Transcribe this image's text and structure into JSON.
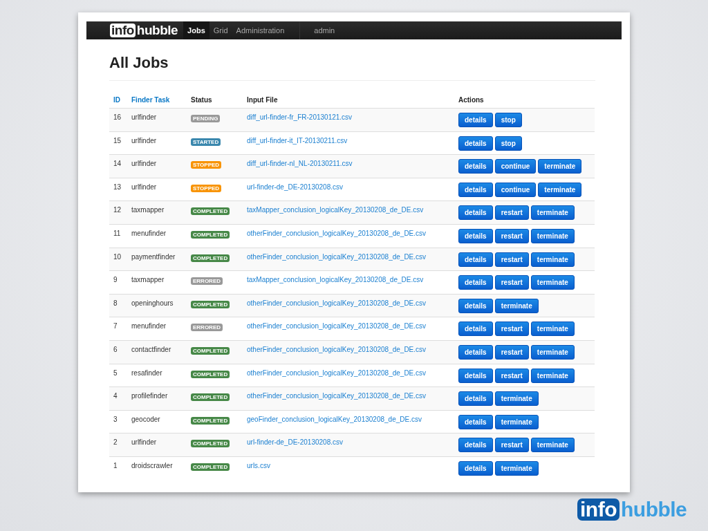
{
  "navbar": {
    "logo": {
      "part_1": "info",
      "part_2": "hubble"
    },
    "items": [
      {
        "label": "Jobs",
        "selected": true
      },
      {
        "label": "Grid",
        "selected": false
      },
      {
        "label": "Administration",
        "selected": false
      }
    ],
    "user": "admin"
  },
  "title": "All Jobs",
  "table": {
    "columns": [
      "ID",
      "Finder Task",
      "Status",
      "Input File",
      "Actions"
    ],
    "rows": [
      {
        "id": "16",
        "task": "urlfinder",
        "status": {
          "label": "PENDING",
          "kind": "pending"
        },
        "file": "diff_url-finder-fr_FR-20130121.csv",
        "actions": [
          "details",
          "stop"
        ]
      },
      {
        "id": "15",
        "task": "urlfinder",
        "status": {
          "label": "STARTED",
          "kind": "started"
        },
        "file": "diff_url-finder-it_IT-20130211.csv",
        "actions": [
          "details",
          "stop"
        ]
      },
      {
        "id": "14",
        "task": "urlfinder",
        "status": {
          "label": "STOPPED",
          "kind": "stopped"
        },
        "file": "diff_url-finder-nl_NL-20130211.csv",
        "actions": [
          "details",
          "continue",
          "terminate"
        ]
      },
      {
        "id": "13",
        "task": "urlfinder",
        "status": {
          "label": "STOPPED",
          "kind": "stopped"
        },
        "file": "url-finder-de_DE-20130208.csv",
        "actions": [
          "details",
          "continue",
          "terminate"
        ]
      },
      {
        "id": "12",
        "task": "taxmapper",
        "status": {
          "label": "COMPLETED",
          "kind": "completed"
        },
        "file": "taxMapper_conclusion_logicalKey_20130208_de_DE.csv",
        "actions": [
          "details",
          "restart",
          "terminate"
        ]
      },
      {
        "id": "11",
        "task": "menufinder",
        "status": {
          "label": "COMPLETED",
          "kind": "completed"
        },
        "file": "otherFinder_conclusion_logicalKey_20130208_de_DE.csv",
        "actions": [
          "details",
          "restart",
          "terminate"
        ]
      },
      {
        "id": "10",
        "task": "paymentfinder",
        "status": {
          "label": "COMPLETED",
          "kind": "completed"
        },
        "file": "otherFinder_conclusion_logicalKey_20130208_de_DE.csv",
        "actions": [
          "details",
          "restart",
          "terminate"
        ]
      },
      {
        "id": "9",
        "task": "taxmapper",
        "status": {
          "label": "ERRORED",
          "kind": "errored"
        },
        "file": "taxMapper_conclusion_logicalKey_20130208_de_DE.csv",
        "actions": [
          "details",
          "restart",
          "terminate"
        ]
      },
      {
        "id": "8",
        "task": "openinghours",
        "status": {
          "label": "COMPLETED",
          "kind": "completed"
        },
        "file": "otherFinder_conclusion_logicalKey_20130208_de_DE.csv",
        "actions": [
          "details",
          "terminate"
        ]
      },
      {
        "id": "7",
        "task": "menufinder",
        "status": {
          "label": "ERRORED",
          "kind": "errored"
        },
        "file": "otherFinder_conclusion_logicalKey_20130208_de_DE.csv",
        "actions": [
          "details",
          "restart",
          "terminate"
        ]
      },
      {
        "id": "6",
        "task": "contactfinder",
        "status": {
          "label": "COMPLETED",
          "kind": "completed"
        },
        "file": "otherFinder_conclusion_logicalKey_20130208_de_DE.csv",
        "actions": [
          "details",
          "restart",
          "terminate"
        ]
      },
      {
        "id": "5",
        "task": "resafinder",
        "status": {
          "label": "COMPLETED",
          "kind": "completed"
        },
        "file": "otherFinder_conclusion_logicalKey_20130208_de_DE.csv",
        "actions": [
          "details",
          "restart",
          "terminate"
        ]
      },
      {
        "id": "4",
        "task": "profilefinder",
        "status": {
          "label": "COMPLETED",
          "kind": "completed"
        },
        "file": "otherFinder_conclusion_logicalKey_20130208_de_DE.csv",
        "actions": [
          "details",
          "terminate"
        ]
      },
      {
        "id": "3",
        "task": "geocoder",
        "status": {
          "label": "COMPLETED",
          "kind": "completed"
        },
        "file": "geoFinder_conclusion_logicalKey_20130208_de_DE.csv",
        "actions": [
          "details",
          "terminate"
        ]
      },
      {
        "id": "2",
        "task": "urlfinder",
        "status": {
          "label": "COMPLETED",
          "kind": "completed"
        },
        "file": "url-finder-de_DE-20130208.csv",
        "actions": [
          "details",
          "restart",
          "terminate"
        ]
      },
      {
        "id": "1",
        "task": "droidscrawler",
        "status": {
          "label": "COMPLETED",
          "kind": "completed"
        },
        "file": "urls.csv",
        "actions": [
          "details",
          "terminate"
        ]
      }
    ]
  },
  "slide_logo": {
    "part_1": "info",
    "part_2": "hubble"
  }
}
